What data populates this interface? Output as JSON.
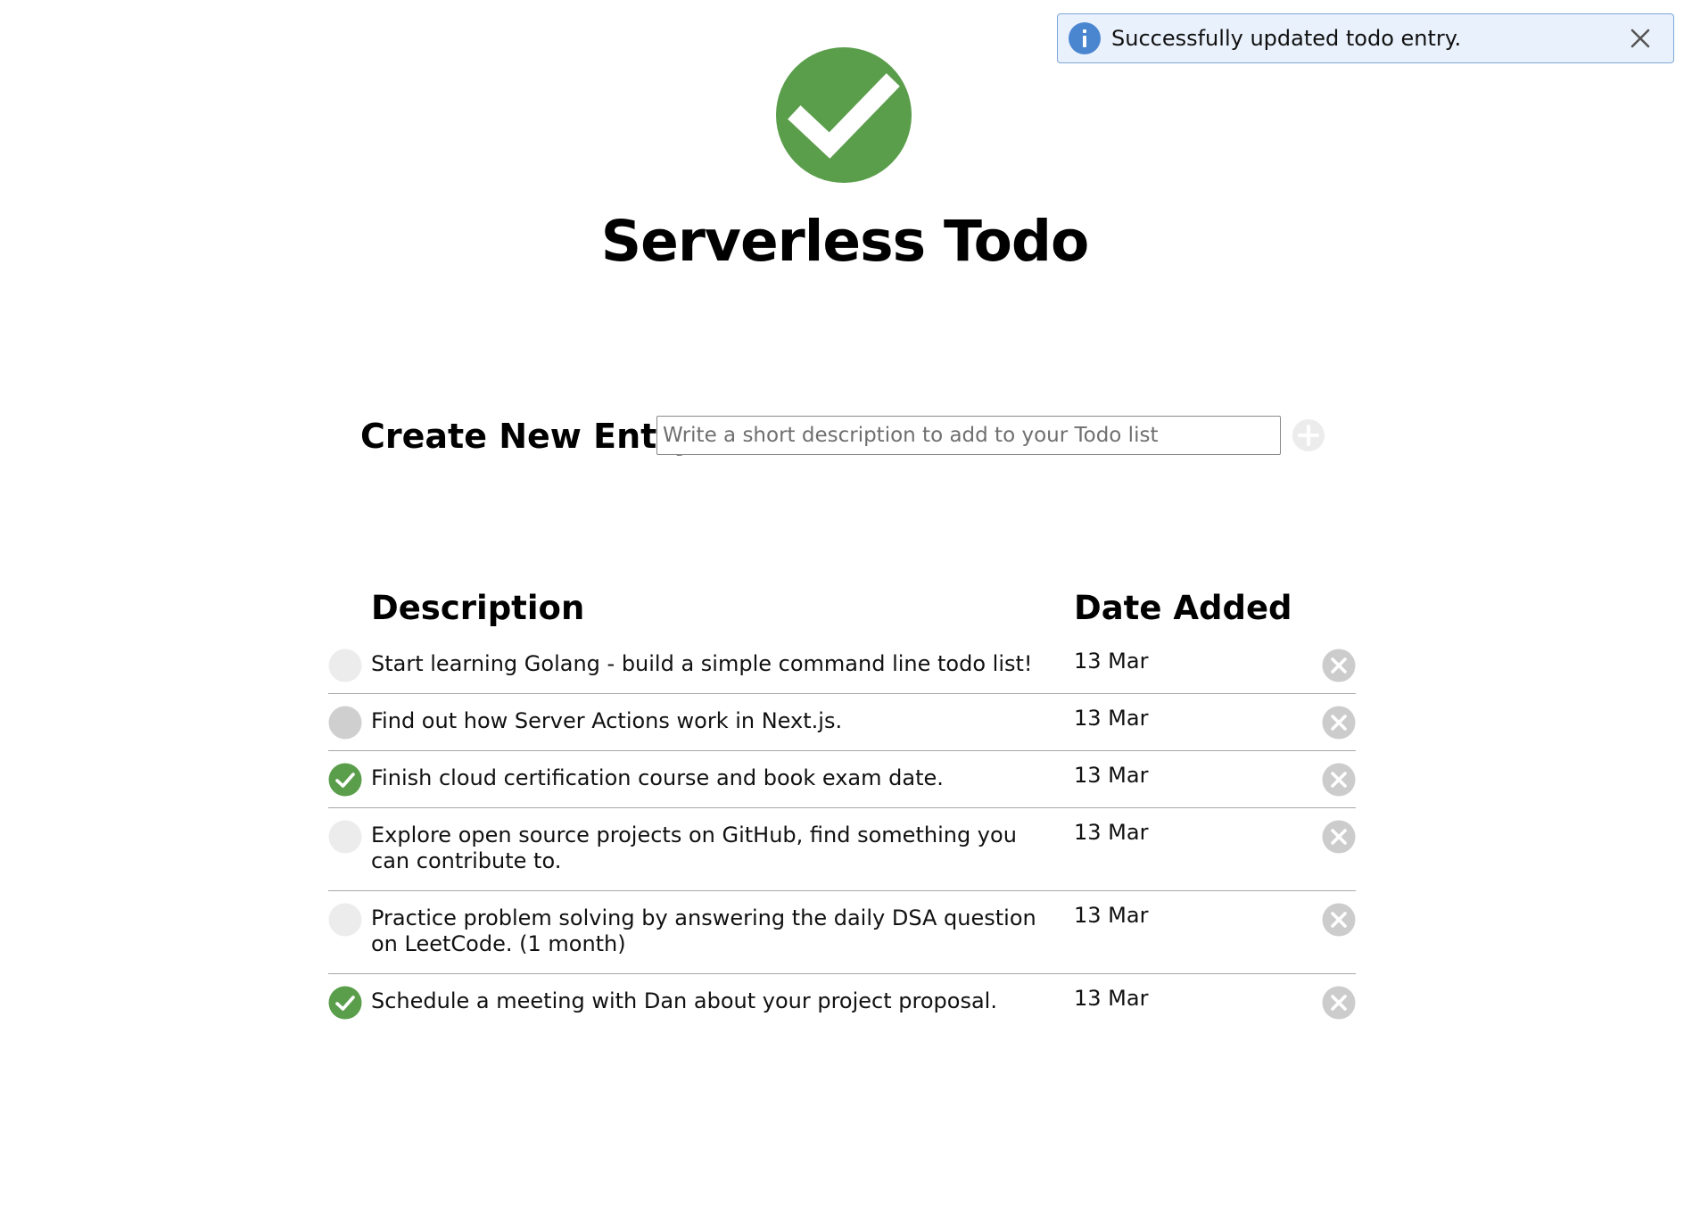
{
  "toast": {
    "message": "Successfully updated todo entry.",
    "icon": "info-icon",
    "close_icon": "close-icon",
    "accent_color": "#4a86d0",
    "background": "#e9f1fc"
  },
  "app": {
    "title": "Serverless Todo",
    "logo_icon": "check-circle-icon",
    "brand_color": "#5a9e4b"
  },
  "create": {
    "label": "Create New Entry:",
    "value": "",
    "placeholder": "Write a short description to add to your Todo list",
    "add_icon": "plus-circle-icon"
  },
  "table": {
    "columns": {
      "description": "Description",
      "date_added": "Date Added"
    },
    "rows": [
      {
        "description": "Start learning Golang - build a simple command line todo list!",
        "date": "13 Mar",
        "status": "incomplete"
      },
      {
        "description": "Find out how Server Actions work in Next.js.",
        "date": "13 Mar",
        "status": "hover"
      },
      {
        "description": "Finish cloud certification course and book exam date.",
        "date": "13 Mar",
        "status": "complete"
      },
      {
        "description": "Explore open source projects on GitHub, find something you can contribute to.",
        "date": "13 Mar",
        "status": "incomplete"
      },
      {
        "description": "Practice problem solving by answering the daily DSA question on LeetCode. (1 month)",
        "date": "13 Mar",
        "status": "incomplete"
      },
      {
        "description": "Schedule a meeting with Dan about your project proposal.",
        "date": "13 Mar",
        "status": "complete"
      }
    ]
  },
  "colors": {
    "complete": "#5a9e4b",
    "incomplete": "#ececec",
    "hover": "#cfcfcf",
    "delete": "#cccccc"
  }
}
